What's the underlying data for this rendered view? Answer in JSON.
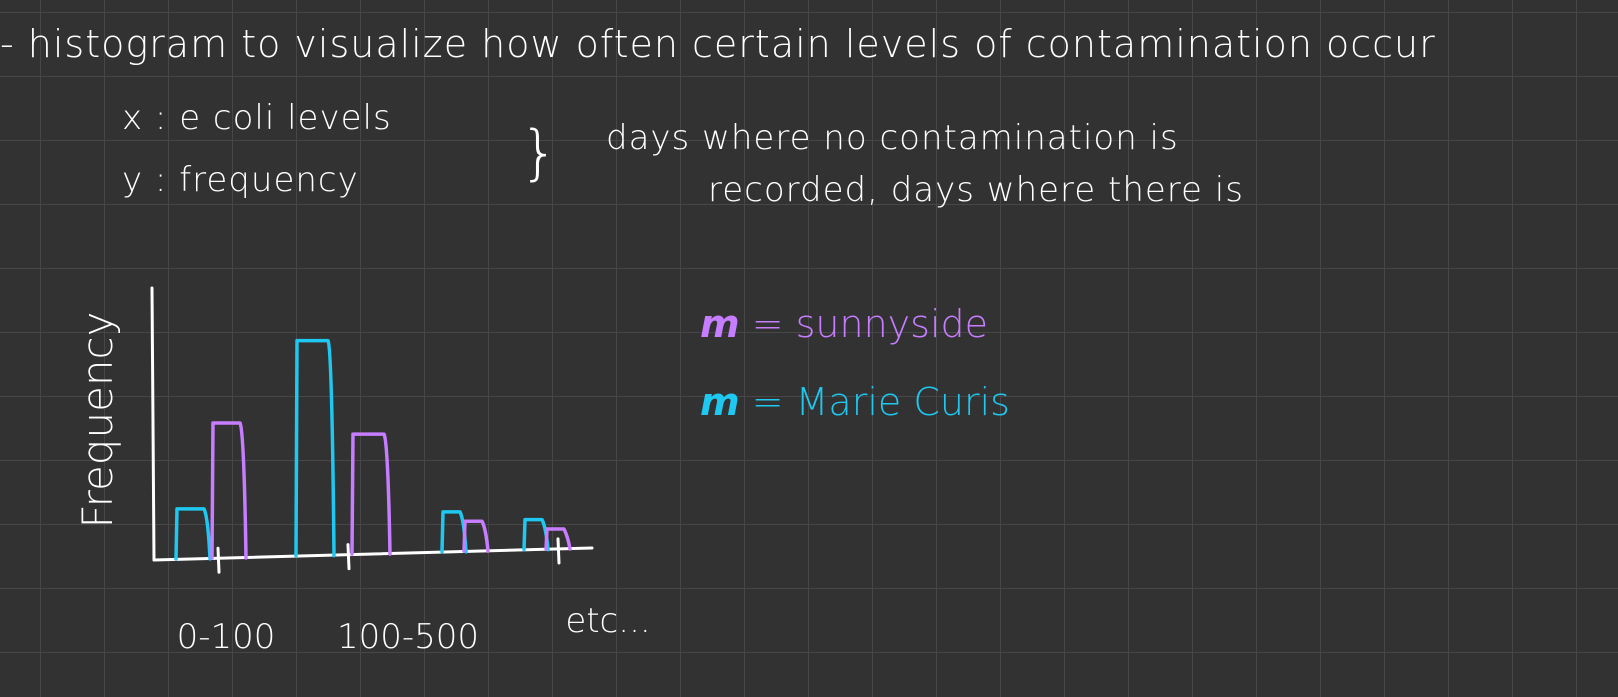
{
  "notes": {
    "line1": "- histogram to visualize how often certain levels of contamination occur",
    "line2": "x : e coli levels",
    "line3": "y : frequency",
    "brace": "}",
    "line4": "days where no contamination is",
    "line5": "recorded, days where there is"
  },
  "legend": {
    "items": [
      {
        "glyph": "m",
        "label": "= sunnyside",
        "color": "#c77dff"
      },
      {
        "glyph": "m",
        "label": "= Marie Curis",
        "color": "#1ec8f0"
      }
    ]
  },
  "colors": {
    "ink": "#ffffff",
    "sunnyside": "#c77dff",
    "marie_curis": "#1ec8f0",
    "background": "#323232"
  },
  "chart_data": {
    "type": "bar",
    "title": "",
    "xlabel": "",
    "ylabel": "Frequency",
    "categories": [
      "0-100",
      "",
      "100-500",
      "",
      "etc..."
    ],
    "series": [
      {
        "name": "Marie Curis",
        "color": "#1ec8f0",
        "values": [
          2,
          0,
          8.6,
          1.6,
          1.2
        ]
      },
      {
        "name": "sunnyside",
        "color": "#c77dff",
        "values": [
          5.4,
          0,
          4.8,
          1.2,
          0.8
        ]
      }
    ],
    "ylim": [
      0,
      10
    ],
    "grid": false,
    "legend": "right"
  }
}
